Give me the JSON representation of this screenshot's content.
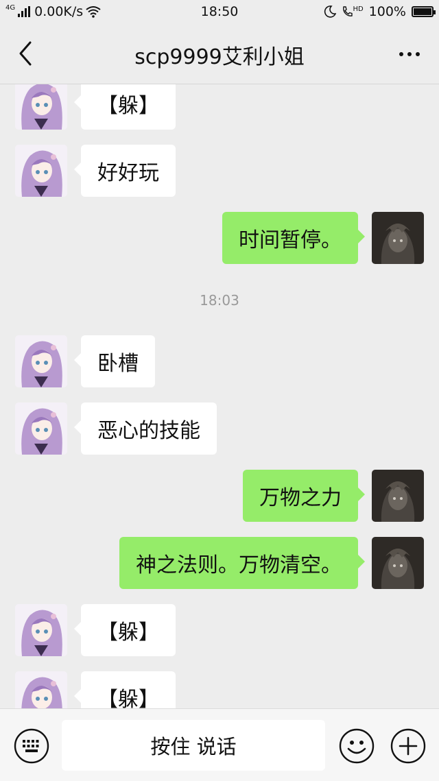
{
  "status_bar": {
    "network": "4G",
    "speed": "0.00K/s",
    "time": "18:50",
    "hd": "HD",
    "battery": "100%"
  },
  "header": {
    "title": "scp9999艾利小姐"
  },
  "chat": {
    "messages": [
      {
        "side": "left",
        "text": "【躲】"
      },
      {
        "side": "left",
        "text": "好好玩"
      },
      {
        "side": "right",
        "text": "时间暂停。"
      },
      {
        "side": "time",
        "text": "18:03"
      },
      {
        "side": "left",
        "text": "卧槽"
      },
      {
        "side": "left",
        "text": "恶心的技能"
      },
      {
        "side": "right",
        "text": "万物之力"
      },
      {
        "side": "right",
        "text": "神之法则。万物清空。"
      },
      {
        "side": "left",
        "text": "【躲】"
      },
      {
        "side": "left",
        "text": "【躲】"
      }
    ]
  },
  "input_bar": {
    "hold_to_talk_label": "按住 说话"
  },
  "colors": {
    "background": "#ededed",
    "sent_bubble": "#95ec69",
    "received_bubble": "#ffffff"
  }
}
